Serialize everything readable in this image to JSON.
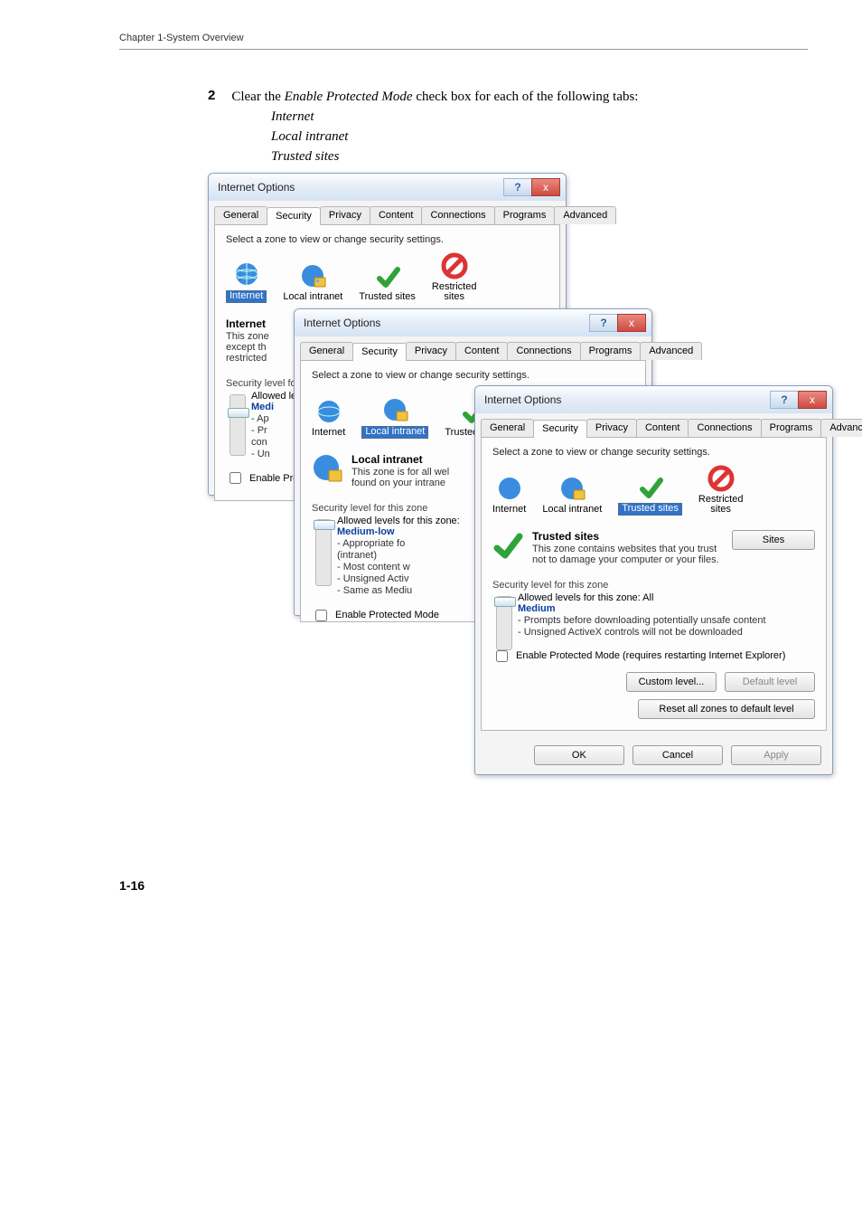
{
  "chapter": "Chapter 1-System Overview",
  "step": {
    "num": "2",
    "text_pre": "Clear the ",
    "text_em": "Enable Protected Mode",
    "text_post": " check box for each of the following tabs:"
  },
  "sub": {
    "a": "Internet",
    "b": "Local intranet",
    "c": "Trusted sites"
  },
  "dlg": {
    "title": "Internet Options",
    "help_glyph": "?",
    "close_glyph": "x",
    "tabs": {
      "general": "General",
      "security": "Security",
      "privacy": "Privacy",
      "content": "Content",
      "connections": "Connections",
      "programs": "Programs",
      "advanced": "Advanced"
    },
    "select_caption": "Select a zone to view or change security settings.",
    "zones": {
      "internet": "Internet",
      "local": "Local intranet",
      "trusted": "Trusted sites",
      "restricted_l1": "Restricted",
      "restricted_l2": "sites"
    }
  },
  "d1": {
    "zname": "Internet",
    "zdesc1": "This zone",
    "zdesc2": "except th",
    "zdesc3": "restricted",
    "sec_label": "Security level for",
    "allowed": "Allowed levels f",
    "level": "Medi",
    "b1": "- Ap",
    "b2": "- Pr",
    "b3": "  con",
    "b4": "- Un",
    "chk": "Enable Pro"
  },
  "d2": {
    "zname": "Local intranet",
    "zdesc1": "This zone is for all wel",
    "zdesc2": "found on your intrane",
    "sec_label": "Security level for this zone",
    "allowed": "Allowed levels for this zone:",
    "level": "Medium-low",
    "b1": "- Appropriate fo",
    "b2": "(intranet)",
    "b3": "- Most content w",
    "b4": "- Unsigned Activ",
    "b5": "- Same as Mediu",
    "chk": "Enable Protected Mode"
  },
  "d3": {
    "zname": "Trusted sites",
    "zdesc": "This zone contains websites that you trust not to damage your computer or your files.",
    "sites_btn": "Sites",
    "sec_label": "Security level for this zone",
    "allowed": "Allowed levels for this zone: All",
    "level": "Medium",
    "b1": "- Prompts before downloading potentially unsafe content",
    "b2": "- Unsigned ActiveX controls will not be downloaded",
    "chk": "Enable Protected Mode (requires restarting Internet Explorer)",
    "custom": "Custom level...",
    "def": "Default level",
    "reset": "Reset all zones to default level",
    "ok": "OK",
    "cancel": "Cancel",
    "apply": "Apply"
  },
  "page_num": "1-16"
}
